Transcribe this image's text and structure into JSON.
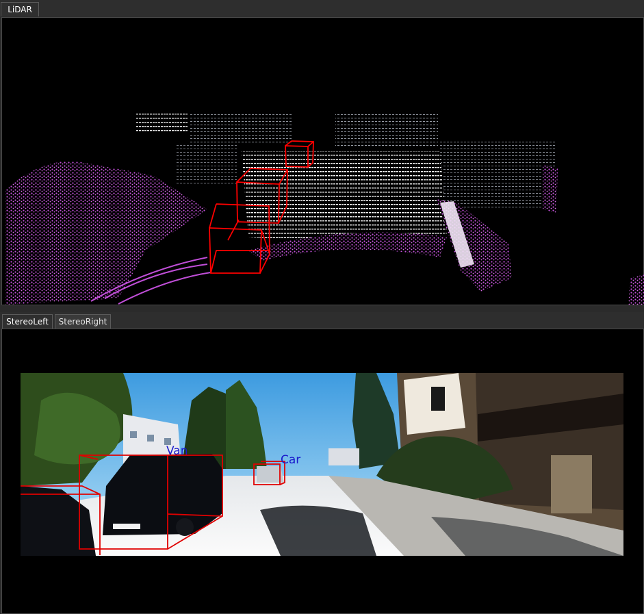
{
  "lidar_panel": {
    "tab_label": "LiDAR",
    "accent_colors": {
      "bbox": "#ff0000",
      "near_points": "#c94ee0",
      "far_points": "#ffffff"
    }
  },
  "stereo_panel": {
    "tabs": [
      {
        "label": "StereoLeft",
        "active": true
      },
      {
        "label": "StereoRight",
        "active": false
      }
    ],
    "detections": [
      {
        "label": "Van"
      },
      {
        "label": "Car"
      }
    ],
    "accent_colors": {
      "bbox": "#e00000",
      "label": "#1a1acc"
    }
  }
}
